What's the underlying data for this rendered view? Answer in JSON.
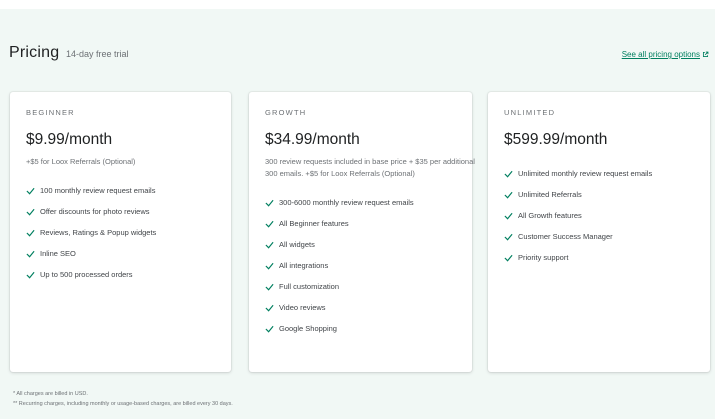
{
  "header": {
    "title": "Pricing",
    "subtitle": "14-day free trial",
    "all_pricing_link": "See all pricing options"
  },
  "colors": {
    "accent_green": "#007f5f",
    "panel_background": "#f1f8f5"
  },
  "icons": {
    "feature_check": "check-icon",
    "external_link": "external-link-icon"
  },
  "plans": [
    {
      "name": "BEGINNER",
      "price": "$9.99/month",
      "note": "+$5 for Loox Referrals (Optional)",
      "features": [
        "100 monthly review request emails",
        "Offer discounts for photo reviews",
        "Reviews, Ratings & Popup widgets",
        "Inline SEO",
        "Up to 500 processed orders"
      ]
    },
    {
      "name": "GROWTH",
      "price": "$34.99/month",
      "note": "300 review requests included in base price + $35 per additional 300 emails. +$5 for Loox Referrals (Optional)",
      "features": [
        "300-6000 monthly review request emails",
        "All Beginner features",
        "All widgets",
        "All integrations",
        "Full customization",
        "Video reviews",
        "Google Shopping"
      ]
    },
    {
      "name": "UNLIMITED",
      "price": "$599.99/month",
      "note": "",
      "features": [
        "Unlimited monthly review request emails",
        "Unlimited Referrals",
        "All Growth features",
        "Customer Success Manager",
        "Priority support"
      ]
    }
  ],
  "footnotes": [
    "* All charges are billed in USD.",
    "** Recurring charges, including monthly or usage-based charges, are billed every 30 days."
  ]
}
